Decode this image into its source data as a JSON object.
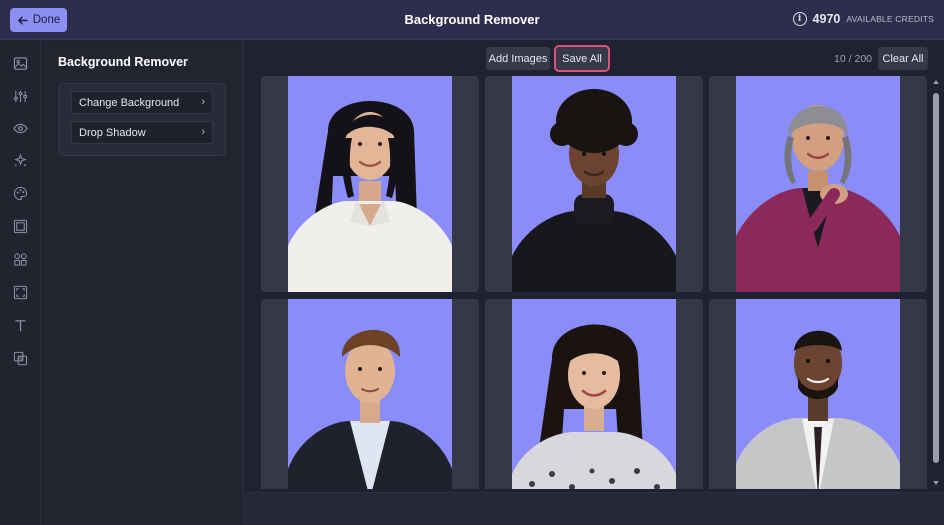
{
  "topbar": {
    "done_label": "Done",
    "title": "Background Remover",
    "credits_value": "4970",
    "credits_label": "AVAILABLE CREDITS"
  },
  "sidebar_rail": {
    "icons": [
      "image-icon",
      "adjustments-icon",
      "eye-icon",
      "sparkle-icon",
      "palette-icon",
      "frame-icon",
      "elements-icon",
      "crop-icon",
      "text-icon",
      "layers-icon"
    ]
  },
  "panel": {
    "title": "Background Remover",
    "items": [
      {
        "label": "Change Background"
      },
      {
        "label": "Drop Shadow"
      }
    ]
  },
  "toolbar": {
    "add_images_label": "Add Images",
    "save_all_label": "Save All",
    "image_count": "10 / 200",
    "clear_all_label": "Clear All"
  },
  "images": [
    {
      "subject": "woman-long-black-hair-white-shirt"
    },
    {
      "subject": "woman-curly-hair-black-turtleneck"
    },
    {
      "subject": "woman-gray-hair-magenta-blazer"
    },
    {
      "subject": "man-brown-hair-dark-suit"
    },
    {
      "subject": "woman-long-dark-hair-patterned-top"
    },
    {
      "subject": "man-beard-light-suit"
    }
  ],
  "colors": {
    "accent": "#8b8ff0",
    "photo_background": "#8a8cf8",
    "highlight": "#e0507d",
    "topbar": "#2f2d4d"
  }
}
